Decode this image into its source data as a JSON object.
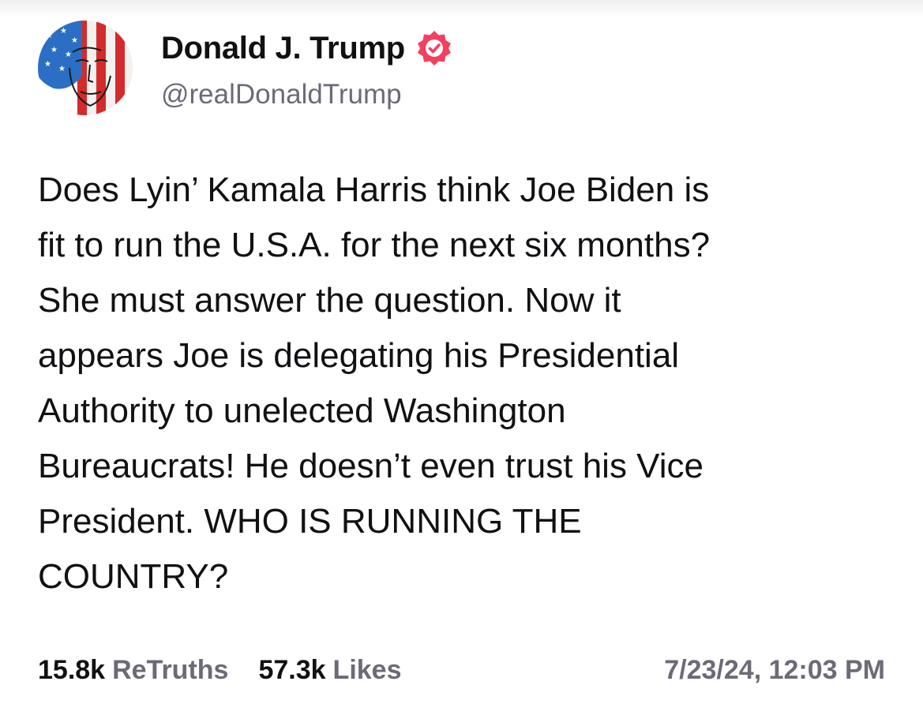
{
  "author": {
    "display_name": "Donald J. Trump",
    "handle": "@realDonaldTrump",
    "avatar_icon": "flag-portrait-avatar",
    "verified_icon": "verified-badge-icon",
    "verified_color": "#f43f5e"
  },
  "post": {
    "text": "Does Lyin’ Kamala Harris think Joe Biden is\nfit to run the U.S.A. for the next six months?\nShe must answer the question. Now it\nappears Joe is delegating his Presidential\nAuthority to unelected Washington\nBureaucrats! He doesn’t even trust his Vice\nPresident. WHO IS RUNNING THE\nCOUNTRY?"
  },
  "stats": {
    "retruths_count": "15.8k",
    "retruths_label": "ReTruths",
    "likes_count": "57.3k",
    "likes_label": "Likes"
  },
  "timestamp": "7/23/24, 12:03 PM"
}
